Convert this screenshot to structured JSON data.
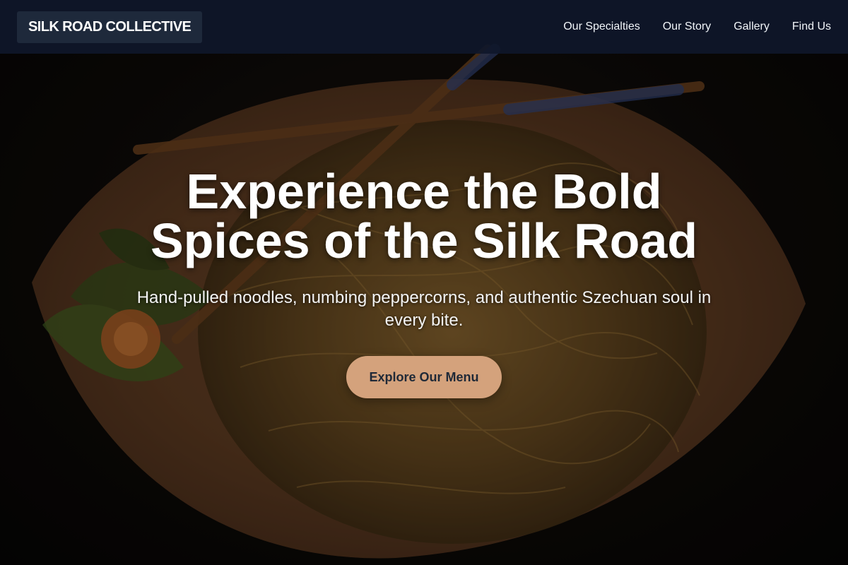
{
  "brand": {
    "name": "SILK ROAD COLLECTIVE"
  },
  "nav": {
    "links": [
      {
        "label": "Our Specialties"
      },
      {
        "label": "Our Story"
      },
      {
        "label": "Gallery"
      },
      {
        "label": "Find Us"
      }
    ]
  },
  "hero": {
    "title": "Experience the Bold Spices of the Silk Road",
    "subtitle": "Hand-pulled noodles, numbing peppercorns, and authentic Szechuan soul in every bite.",
    "cta_label": "Explore Our Menu",
    "background_image": "noodle-plate-with-chopsticks-photo"
  },
  "colors": {
    "nav_background": "#0f172a",
    "brand_background": "#1e293b",
    "cta_background": "#d4a27c",
    "cta_text": "#1f2937"
  }
}
